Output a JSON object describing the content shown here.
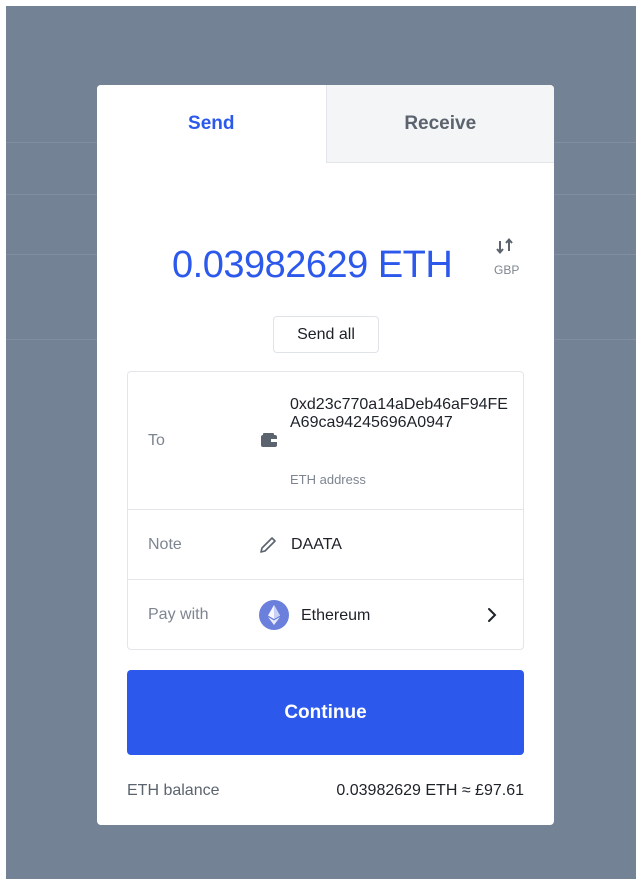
{
  "tabs": [
    {
      "label": "Send",
      "active": true
    },
    {
      "label": "Receive",
      "active": false
    }
  ],
  "amount": {
    "value": "0.03982629 ETH",
    "toggle_currency": "GBP"
  },
  "send_all_label": "Send all",
  "form": {
    "to": {
      "label": "To",
      "address": "0xd23c770a14aDeb46aF94FEA69ca94245696A0947",
      "address_type": "ETH address",
      "icon": "wallet-icon"
    },
    "note": {
      "label": "Note",
      "value": "DAATA",
      "icon": "pencil-icon"
    },
    "pay_with": {
      "label": "Pay with",
      "value": "Ethereum",
      "icon": "ethereum-icon"
    }
  },
  "continue_label": "Continue",
  "balance": {
    "label": "ETH balance",
    "value": "0.03982629 ETH ≈ £97.61"
  },
  "colors": {
    "accent": "#2c59ec",
    "backdrop": "#738295",
    "ethereum": "#6b7fdc"
  }
}
